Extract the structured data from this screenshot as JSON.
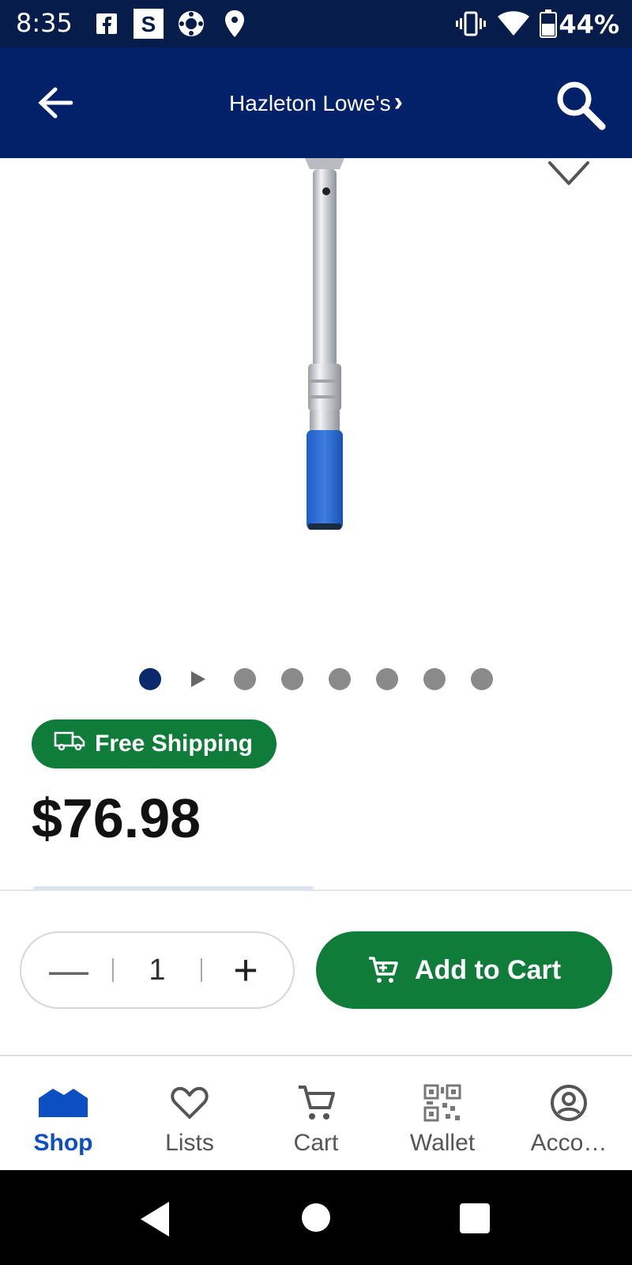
{
  "status": {
    "time": "8:35",
    "battery": "44%",
    "icons": [
      "facebook-icon",
      "s-app-icon",
      "app-icon",
      "location-icon",
      "vibrate-icon",
      "wifi-icon",
      "battery-icon"
    ]
  },
  "header": {
    "store": "Hazleton Lowe's",
    "chevron": "›",
    "icons": [
      "back-arrow-icon",
      "search-icon"
    ]
  },
  "product": {
    "image_alt": "torque wrench product image",
    "image_colors": {
      "handle": "#2a6cd1",
      "body": "#cfd3d8"
    },
    "carousel": {
      "count": 7,
      "active": 0,
      "has_video": true
    }
  },
  "badge": {
    "label": "Free Shipping",
    "icon": "truck-icon",
    "color": "#0f7c3a"
  },
  "price": "$76.98",
  "quantity": {
    "value": "1",
    "minus": "—",
    "plus": "+"
  },
  "add_to_cart": {
    "label": "Add to Cart",
    "icon": "cart-icon",
    "color": "#0f7c3a"
  },
  "tabs": [
    {
      "label": "Shop",
      "icon": "home-icon",
      "active": true
    },
    {
      "label": "Lists",
      "icon": "heart-icon",
      "active": false
    },
    {
      "label": "Cart",
      "icon": "cart-icon",
      "active": false
    },
    {
      "label": "Wallet",
      "icon": "qr-code-icon",
      "active": false
    },
    {
      "label": "Acco…",
      "icon": "account-icon",
      "active": false
    }
  ],
  "colors": {
    "statusbar": "#061c4a",
    "appbar": "#022169",
    "active_tab": "#0b4fc3",
    "active_dot": "#0a2a6b"
  }
}
